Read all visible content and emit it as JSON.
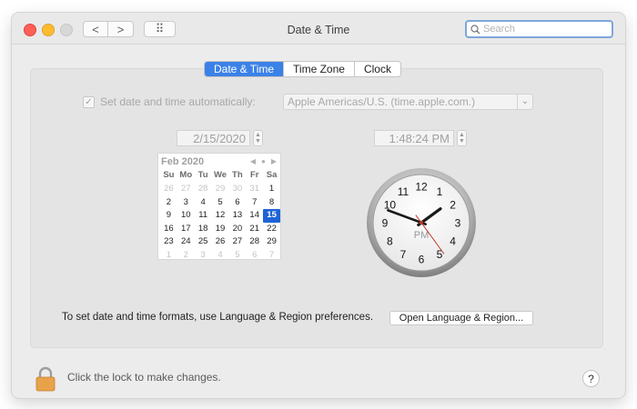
{
  "window": {
    "title": "Date & Time"
  },
  "toolbar": {
    "back_glyph": "<",
    "forward_glyph": ">",
    "show_all_glyph": "⠿"
  },
  "search": {
    "placeholder": "Search",
    "value": ""
  },
  "tabs": [
    {
      "label": "Date & Time",
      "active": true
    },
    {
      "label": "Time Zone",
      "active": false
    },
    {
      "label": "Clock",
      "active": false
    }
  ],
  "auto_set": {
    "checked": true,
    "check_glyph": "✓",
    "label": "Set date and time automatically:",
    "server": "Apple Americas/U.S. (time.apple.com.)",
    "chevron": "⌄"
  },
  "date_field": {
    "value": "2/15/2020"
  },
  "time_field": {
    "value": "1:48:24 PM"
  },
  "stepper": {
    "up": "▲",
    "down": "▼"
  },
  "calendar": {
    "month": "Feb 2020",
    "nav": [
      "◀",
      "●",
      "▶"
    ],
    "weekdays": [
      "Su",
      "Mo",
      "Tu",
      "We",
      "Th",
      "Fr",
      "Sa"
    ],
    "weeks": [
      [
        "26",
        "27",
        "28",
        "29",
        "30",
        "31",
        "1"
      ],
      [
        "2",
        "3",
        "4",
        "5",
        "6",
        "7",
        "8"
      ],
      [
        "9",
        "10",
        "11",
        "12",
        "13",
        "14",
        "15"
      ],
      [
        "16",
        "17",
        "18",
        "19",
        "20",
        "21",
        "22"
      ],
      [
        "23",
        "24",
        "25",
        "26",
        "27",
        "28",
        "29"
      ],
      [
        "1",
        "2",
        "3",
        "4",
        "5",
        "6",
        "7"
      ]
    ],
    "muted_before_count": 6,
    "muted_after_count": 7,
    "selected_day": "15"
  },
  "clock": {
    "numerals": [
      "12",
      "1",
      "2",
      "3",
      "4",
      "5",
      "6",
      "7",
      "8",
      "9",
      "10",
      "11"
    ],
    "period": "PM",
    "hour": 1,
    "minute": 48,
    "second": 24,
    "hand_color": "#1a1a1a",
    "second_hand_color": "#c0392b"
  },
  "formats_hint": "To set date and time formats, use Language & Region preferences.",
  "open_button": "Open Language & Region...",
  "lock": {
    "text": "Click the lock to make changes.",
    "color": "#e8a34a"
  },
  "help": {
    "glyph": "?"
  },
  "colors": {
    "accent": "#3b82e8",
    "selected_day": "#1e63d7"
  }
}
